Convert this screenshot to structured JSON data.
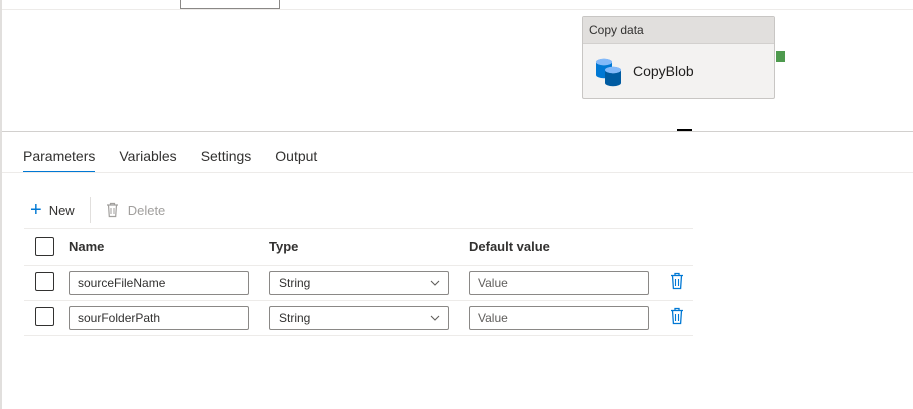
{
  "canvas": {
    "activity": {
      "type_label": "Copy data",
      "name": "CopyBlob",
      "icon": "database-icon"
    }
  },
  "tabs": [
    {
      "label": "Parameters",
      "active": true
    },
    {
      "label": "Variables",
      "active": false
    },
    {
      "label": "Settings",
      "active": false
    },
    {
      "label": "Output",
      "active": false
    }
  ],
  "toolbar": {
    "new_label": "New",
    "delete_label": "Delete"
  },
  "table": {
    "columns": [
      "Name",
      "Type",
      "Default value"
    ],
    "rows": [
      {
        "name": "sourceFileName",
        "type": "String",
        "default_placeholder": "Value"
      },
      {
        "name": "sourFolderPath",
        "type": "String",
        "default_placeholder": "Value"
      }
    ]
  },
  "colors": {
    "accent": "#0078d4",
    "output_handle": "#4e9a4e"
  }
}
